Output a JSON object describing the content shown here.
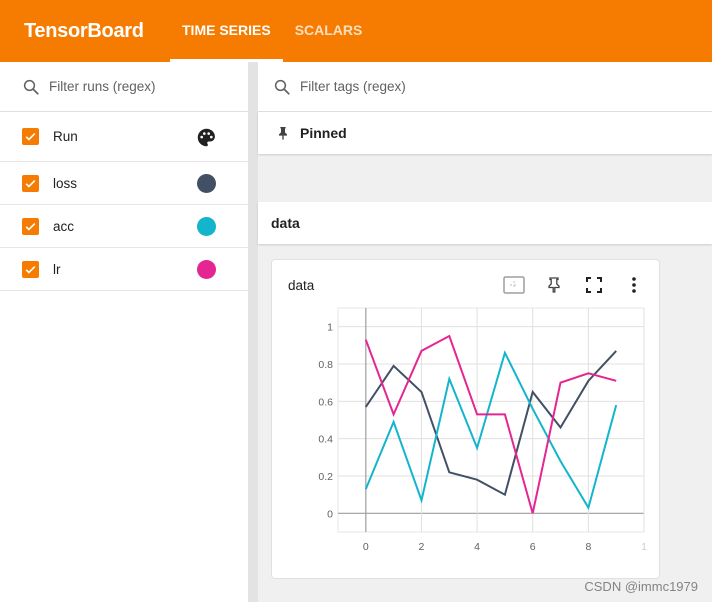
{
  "header": {
    "brand": "TensorBoard",
    "tabs": [
      {
        "label": "TIME SERIES",
        "active": true
      },
      {
        "label": "SCALARS",
        "active": false
      }
    ]
  },
  "runs": {
    "filter_placeholder": "Filter runs (regex)",
    "header_label": "Run",
    "items": [
      {
        "label": "loss",
        "color": "#425066"
      },
      {
        "label": "acc",
        "color": "#12b5cb"
      },
      {
        "label": "lr",
        "color": "#e52592"
      }
    ],
    "accent": "#f57c00"
  },
  "main": {
    "filter_placeholder": "Filter tags (regex)",
    "pinned_label": "Pinned",
    "group_title": "data",
    "card_title": "data"
  },
  "chart_data": {
    "type": "line",
    "title": "data",
    "xlabel": "",
    "ylabel": "",
    "x": [
      0,
      1,
      2,
      3,
      4,
      5,
      6,
      7,
      8,
      9
    ],
    "xlim": [
      -1,
      10
    ],
    "ylim": [
      -0.1,
      1.1
    ],
    "xticks": [
      "0",
      "2",
      "4",
      "6",
      "8",
      "1"
    ],
    "yticks": [
      "0",
      "0.2",
      "0.4",
      "0.6",
      "0.8",
      "1"
    ],
    "grid": true,
    "series": [
      {
        "name": "loss",
        "color": "#425066",
        "values": [
          0.57,
          0.79,
          0.65,
          0.22,
          0.18,
          0.1,
          0.65,
          0.46,
          0.71,
          0.87
        ]
      },
      {
        "name": "acc",
        "color": "#12b5cb",
        "values": [
          0.13,
          0.49,
          0.07,
          0.72,
          0.35,
          0.86,
          0.56,
          0.28,
          0.03,
          0.58
        ]
      },
      {
        "name": "lr",
        "color": "#e52592",
        "values": [
          0.93,
          0.53,
          0.87,
          0.95,
          0.53,
          0.53,
          0.0,
          0.7,
          0.75,
          0.71
        ]
      }
    ]
  },
  "watermark": "CSDN @immc1979"
}
